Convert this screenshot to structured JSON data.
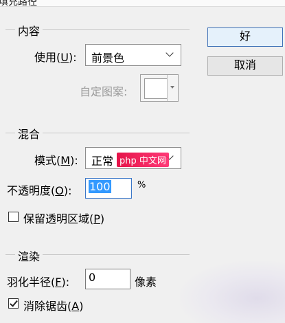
{
  "window": {
    "title": "填充路径"
  },
  "content_group": {
    "legend": "内容",
    "use_label": "使用",
    "use_mnemonic": "U",
    "use_value": "前景色",
    "custom_pattern_label": "自定图案:"
  },
  "blending_group": {
    "legend": "混合",
    "mode_label": "模式",
    "mode_mnemonic": "M",
    "mode_value": "正常",
    "opacity_label": "不透明度",
    "opacity_mnemonic": "O",
    "opacity_value": "100",
    "opacity_unit": "%",
    "preserve_label": "保留透明区域",
    "preserve_mnemonic": "P",
    "preserve_checked": false
  },
  "render_group": {
    "legend": "渲染",
    "feather_label": "羽化半径",
    "feather_mnemonic": "F",
    "feather_value": "0",
    "feather_unit": "像素",
    "antialias_label": "消除锯齿",
    "antialias_mnemonic": "A",
    "antialias_checked": true
  },
  "buttons": {
    "ok": "好",
    "cancel": "取消"
  },
  "watermark": {
    "text": "php 中文网"
  }
}
